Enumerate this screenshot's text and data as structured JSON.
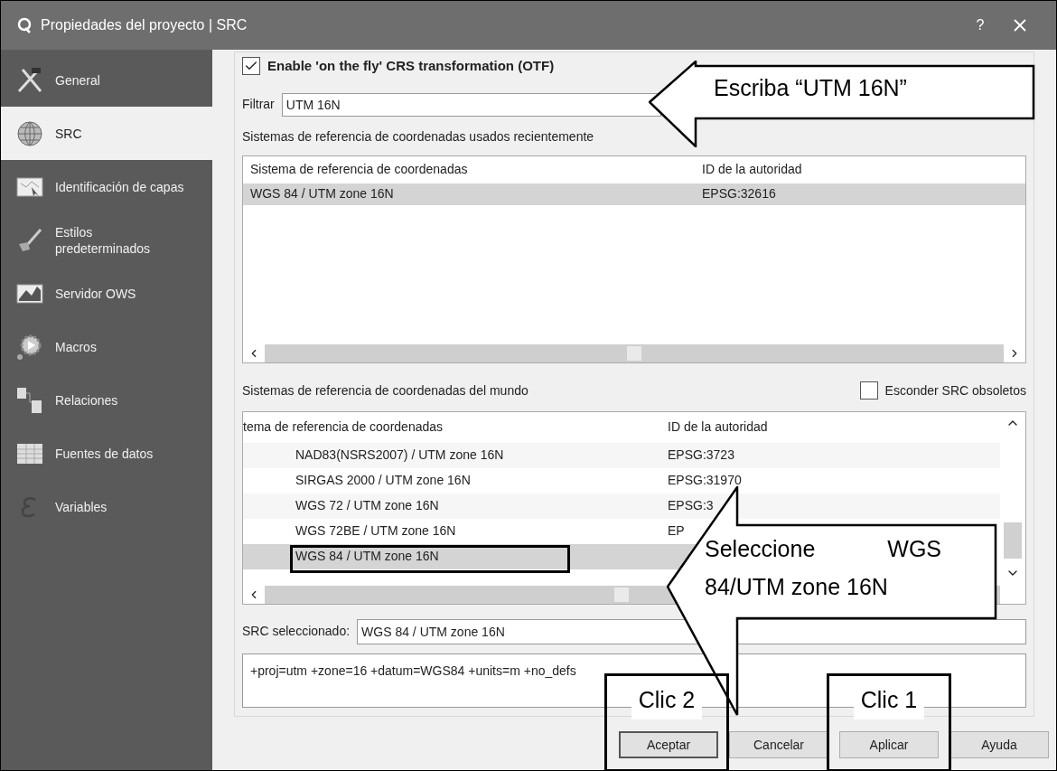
{
  "window": {
    "title": "Propiedades del proyecto | SRC",
    "help": "?"
  },
  "sidebar": {
    "items": [
      {
        "label": "General",
        "selected": false
      },
      {
        "label": "SRC",
        "selected": true
      },
      {
        "label": "Identificación de capas",
        "selected": false
      },
      {
        "label": "Estilos predeterminados",
        "selected": false
      },
      {
        "label": "Servidor OWS",
        "selected": false
      },
      {
        "label": "Macros",
        "selected": false
      },
      {
        "label": "Relaciones",
        "selected": false
      },
      {
        "label": "Fuentes de datos",
        "selected": false
      },
      {
        "label": "Variables",
        "selected": false
      }
    ]
  },
  "otf": {
    "label": "Enable 'on the fly' CRS transformation (OTF)",
    "checked": true
  },
  "filter": {
    "label": "Filtrar",
    "value": "UTM 16N"
  },
  "recent": {
    "title": "Sistemas de referencia de coordenadas usados recientemente",
    "columns": [
      "Sistema de referencia de coordenadas",
      "ID de la autoridad"
    ],
    "rows": [
      {
        "cells": [
          "WGS 84 / UTM zone 16N",
          "EPSG:32616"
        ],
        "selected": true
      }
    ]
  },
  "world": {
    "title": "Sistemas de referencia de coordenadas del mundo",
    "hide_obsolete": {
      "label": "Esconder SRC obsoletos",
      "checked": false
    },
    "columns": [
      "tema de referencia de coordenadas",
      "ID de la autoridad"
    ],
    "rows": [
      {
        "cells": [
          "NAD83(NSRS2007) / UTM zone 16N",
          "EPSG:3723"
        ],
        "selected": false
      },
      {
        "cells": [
          "SIRGAS 2000 / UTM zone 16N",
          "EPSG:31970"
        ],
        "selected": false
      },
      {
        "cells": [
          "WGS 72 / UTM zone 16N",
          "EPSG:3"
        ],
        "selected": false
      },
      {
        "cells": [
          "WGS 72BE / UTM zone 16N",
          "EP"
        ],
        "selected": false
      },
      {
        "cells": [
          "WGS 84 / UTM zone 16N",
          ""
        ],
        "selected": true
      }
    ]
  },
  "selected_crs": {
    "label": "SRC seleccionado:",
    "value": "WGS 84 / UTM zone 16N"
  },
  "proj": "+proj=utm +zone=16 +datum=WGS84 +units=m +no_defs",
  "buttons": [
    {
      "label": "Aceptar",
      "default": true
    },
    {
      "label": "Cancelar",
      "default": false
    },
    {
      "label": "Aplicar",
      "default": false
    },
    {
      "label": "Ayuda",
      "default": false
    }
  ],
  "annotations": [
    {
      "kind": "arrow",
      "text": "Escriba “UTM 16N”"
    },
    {
      "kind": "arrow",
      "text": "Seleccione WGS 84/UTM zone 16N"
    },
    {
      "kind": "box",
      "text": "Clic 2"
    },
    {
      "kind": "box",
      "text": "Clic 1"
    },
    {
      "kind": "outline"
    }
  ]
}
